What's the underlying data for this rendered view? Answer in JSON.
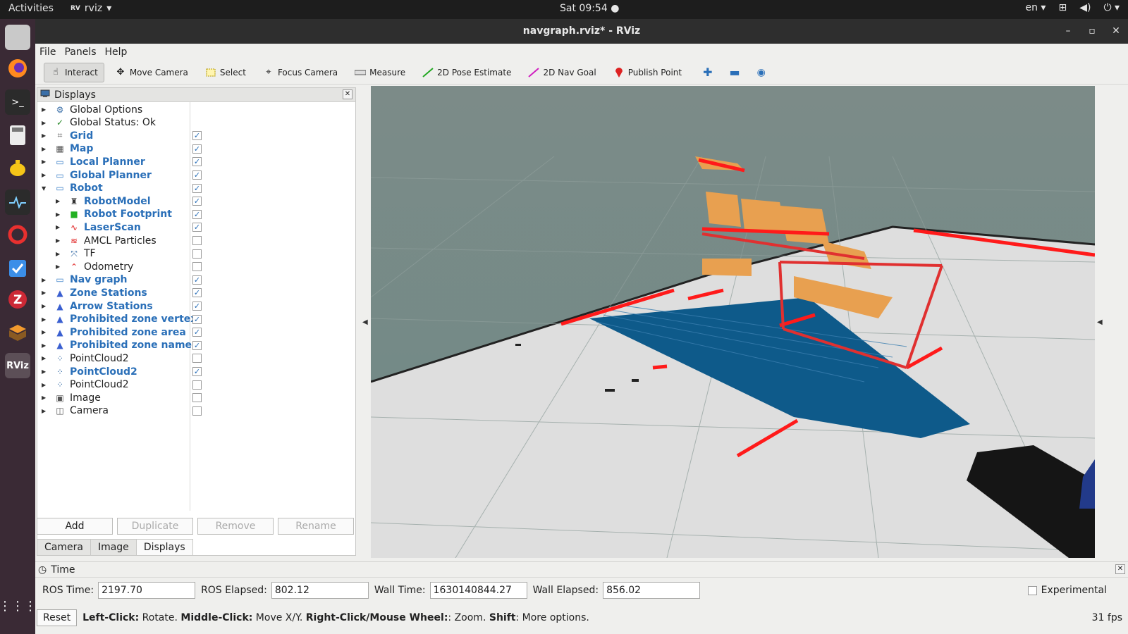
{
  "topbar": {
    "activities": "Activities",
    "app": "rviz",
    "clock": "Sat 09:54",
    "lang": "en"
  },
  "dock": [
    "files-icon",
    "firefox-icon",
    "terminal-icon",
    "calculator-icon",
    "teapot-icon",
    "system-monitor-icon",
    "lifebuoy-icon",
    "tasks-icon",
    "zotero-icon",
    "box-icon",
    "rviz-icon",
    "apps-grid-icon"
  ],
  "window": {
    "title": "navgraph.rviz* - RViz"
  },
  "menu": {
    "file": "File",
    "panels": "Panels",
    "help": "Help"
  },
  "toolbar": {
    "interact": "Interact",
    "move_camera": "Move Camera",
    "select": "Select",
    "focus_camera": "Focus Camera",
    "measure": "Measure",
    "pose_estimate": "2D Pose Estimate",
    "nav_goal": "2D Nav Goal",
    "publish_point": "Publish Point"
  },
  "displays": {
    "title": "Displays",
    "items": [
      {
        "label": "Global Options",
        "blue": false,
        "checkbox": null,
        "indent": 0,
        "expanded": false,
        "icon": "gear-icon"
      },
      {
        "label": "Global Status: Ok",
        "blue": false,
        "checkbox": null,
        "indent": 0,
        "expanded": false,
        "icon": "check-icon"
      },
      {
        "label": "Grid",
        "blue": true,
        "checkbox": true,
        "indent": 0,
        "expanded": false,
        "icon": "grid-icon"
      },
      {
        "label": "Map",
        "blue": true,
        "checkbox": true,
        "indent": 0,
        "expanded": false,
        "icon": "map-icon"
      },
      {
        "label": "Local Planner",
        "blue": true,
        "checkbox": true,
        "indent": 0,
        "expanded": false,
        "icon": "folder-icon"
      },
      {
        "label": "Global Planner",
        "blue": true,
        "checkbox": true,
        "indent": 0,
        "expanded": false,
        "icon": "folder-icon"
      },
      {
        "label": "Robot",
        "blue": true,
        "checkbox": true,
        "indent": 0,
        "expanded": true,
        "icon": "folder-icon"
      },
      {
        "label": "RobotModel",
        "blue": true,
        "checkbox": true,
        "indent": 1,
        "expanded": false,
        "icon": "robot-model-icon"
      },
      {
        "label": "Robot Footprint",
        "blue": true,
        "checkbox": true,
        "indent": 1,
        "expanded": false,
        "icon": "polygon-icon"
      },
      {
        "label": "LaserScan",
        "blue": true,
        "checkbox": true,
        "indent": 1,
        "expanded": false,
        "icon": "laserscan-icon"
      },
      {
        "label": "AMCL Particles",
        "blue": false,
        "checkbox": false,
        "indent": 1,
        "expanded": false,
        "icon": "particles-icon"
      },
      {
        "label": "TF",
        "blue": false,
        "checkbox": false,
        "indent": 1,
        "expanded": false,
        "icon": "tf-icon"
      },
      {
        "label": "Odometry",
        "blue": false,
        "checkbox": false,
        "indent": 1,
        "expanded": false,
        "icon": "odometry-icon"
      },
      {
        "label": "Nav graph",
        "blue": true,
        "checkbox": true,
        "indent": 0,
        "expanded": false,
        "icon": "folder-icon"
      },
      {
        "label": "Zone Stations",
        "blue": true,
        "checkbox": true,
        "indent": 0,
        "expanded": false,
        "icon": "marker-icon"
      },
      {
        "label": "Arrow Stations",
        "blue": true,
        "checkbox": true,
        "indent": 0,
        "expanded": false,
        "icon": "marker-icon"
      },
      {
        "label": "Prohibited zone vertex",
        "blue": true,
        "checkbox": true,
        "indent": 0,
        "expanded": false,
        "icon": "marker-icon"
      },
      {
        "label": "Prohibited zone area",
        "blue": true,
        "checkbox": true,
        "indent": 0,
        "expanded": false,
        "icon": "marker-icon"
      },
      {
        "label": "Prohibited zone name",
        "blue": true,
        "checkbox": true,
        "indent": 0,
        "expanded": false,
        "icon": "marker-icon"
      },
      {
        "label": "PointCloud2",
        "blue": false,
        "checkbox": false,
        "indent": 0,
        "expanded": false,
        "icon": "pointcloud-icon"
      },
      {
        "label": "PointCloud2",
        "blue": true,
        "checkbox": true,
        "indent": 0,
        "expanded": false,
        "icon": "pointcloud-icon"
      },
      {
        "label": "PointCloud2",
        "blue": false,
        "checkbox": false,
        "indent": 0,
        "expanded": false,
        "icon": "pointcloud-icon"
      },
      {
        "label": "Image",
        "blue": false,
        "checkbox": false,
        "indent": 0,
        "expanded": false,
        "icon": "image-icon"
      },
      {
        "label": "Camera",
        "blue": false,
        "checkbox": false,
        "indent": 0,
        "expanded": false,
        "icon": "camera-icon"
      }
    ],
    "buttons": {
      "add": "Add",
      "duplicate": "Duplicate",
      "remove": "Remove",
      "rename": "Rename"
    },
    "tabs": [
      "Camera",
      "Image",
      "Displays"
    ],
    "active_tab": "Displays"
  },
  "time": {
    "title": "Time",
    "ros_time_label": "ROS Time:",
    "ros_time": "2197.70",
    "ros_elapsed_label": "ROS Elapsed:",
    "ros_elapsed": "802.12",
    "wall_time_label": "Wall Time:",
    "wall_time": "1630140844.27",
    "wall_elapsed_label": "Wall Elapsed:",
    "wall_elapsed": "856.02",
    "experimental": "Experimental"
  },
  "status": {
    "reset": "Reset",
    "left_click": "Left-Click:",
    "left_desc": " Rotate. ",
    "middle_click": "Middle-Click:",
    "middle_desc": " Move X/Y. ",
    "right_click": "Right-Click/Mouse Wheel:",
    "right_desc": ": Zoom. ",
    "shift": "Shift",
    "shift_desc": ": More options.",
    "fps": "31 fps"
  },
  "colors": {
    "accent_blue": "#2a6fb8",
    "laser_red": "#ff1a1a",
    "cloud_blue": "#0e5a8a",
    "costmap_orange": "#e8a050"
  }
}
